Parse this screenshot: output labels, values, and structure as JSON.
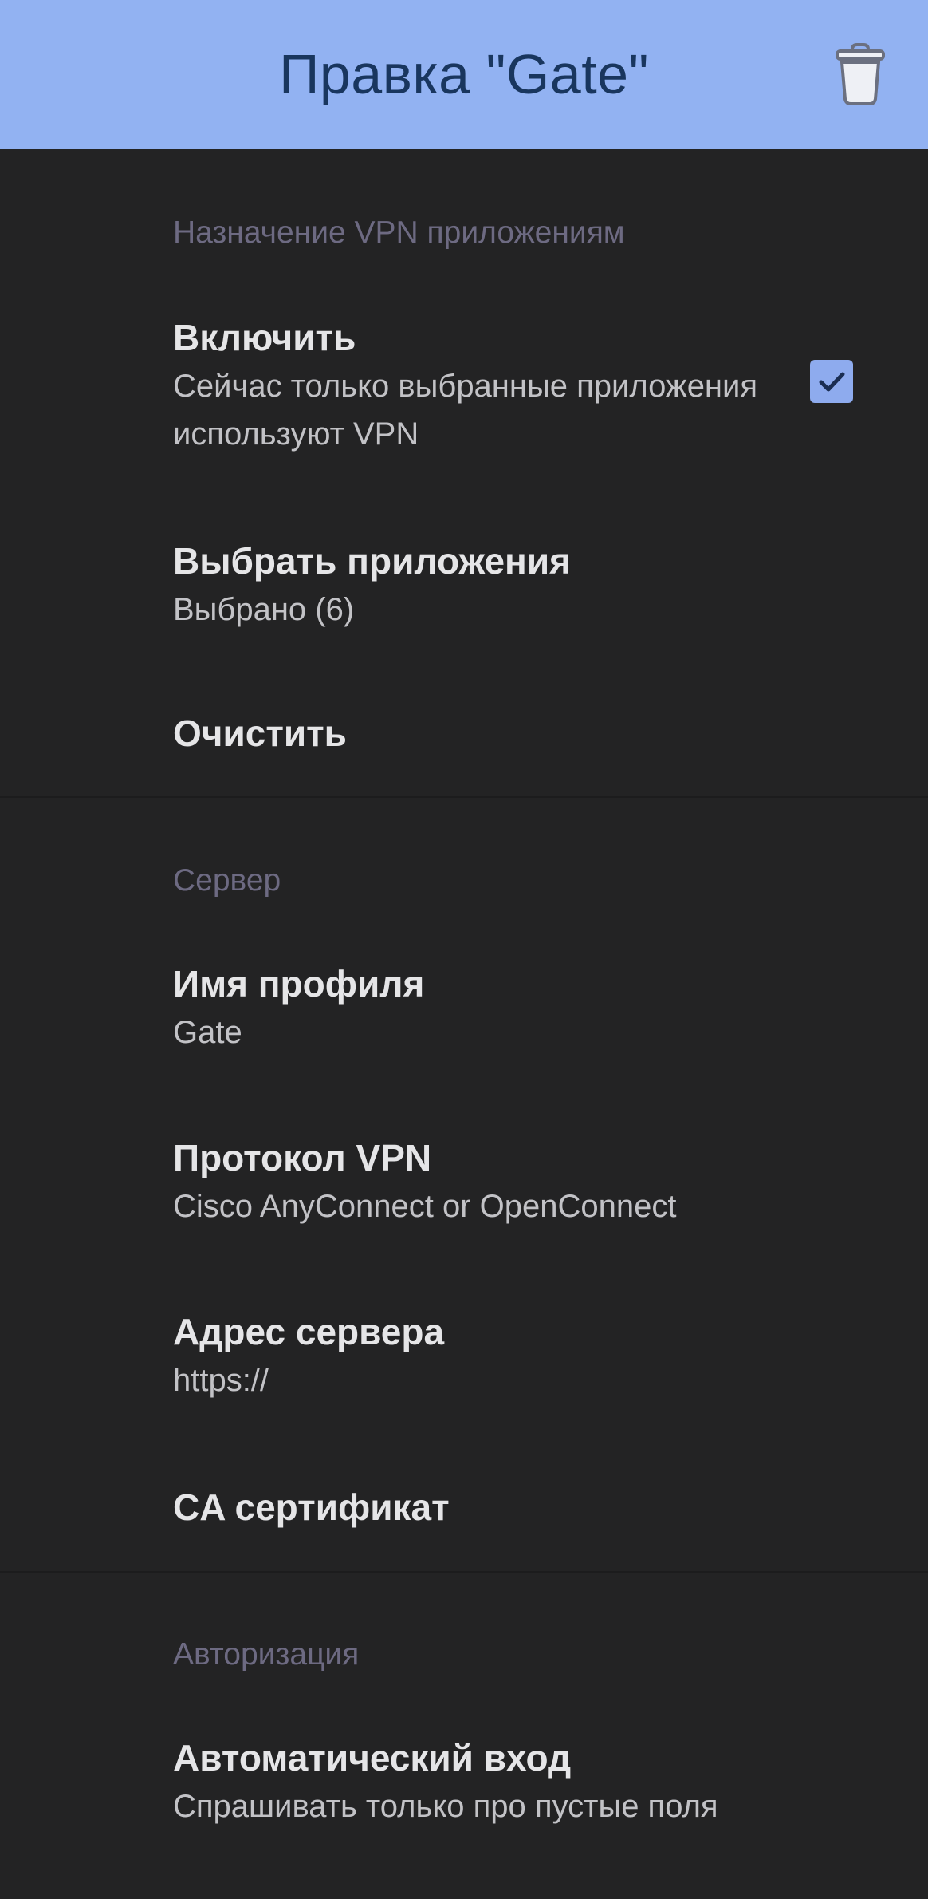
{
  "header": {
    "title": "Правка \"Gate\"",
    "delete_icon": "trash-icon"
  },
  "sections": {
    "vpn_apps": {
      "header": "Назначение VPN приложениям",
      "enable": {
        "title": "Включить",
        "summary": "Сейчас только выбранные приложения используют VPN",
        "checked": true
      },
      "select_apps": {
        "title": "Выбрать приложения",
        "summary": "Выбрано (6)"
      },
      "clear": {
        "title": "Очистить"
      }
    },
    "server": {
      "header": "Сервер",
      "profile_name": {
        "title": "Имя профиля",
        "summary": "Gate"
      },
      "vpn_protocol": {
        "title": "Протокол VPN",
        "summary": "Cisco AnyConnect or OpenConnect"
      },
      "server_address": {
        "title": "Адрес сервера",
        "summary": "https://"
      },
      "ca_certificate": {
        "title": "CA сертификат"
      }
    },
    "authorization": {
      "header": "Авторизация",
      "auto_login": {
        "title": "Автоматический вход",
        "summary": "Спрашивать только про пустые поля"
      }
    }
  },
  "colors": {
    "topbar": "#92b2f2",
    "background": "#232324",
    "accent": "#8eabee",
    "section_header": "#6d6a82",
    "title_text": "#19365e"
  }
}
